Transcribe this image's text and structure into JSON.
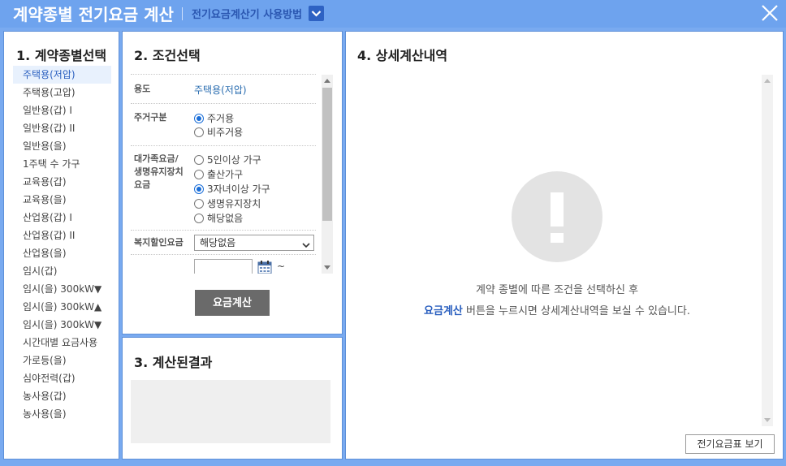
{
  "header": {
    "title": "계약종별 전기요금 계산",
    "help_link": "전기요금계산기 사용방법"
  },
  "panel1": {
    "title": "1. 계약종별선택",
    "items": [
      {
        "label": "주택용(저압)",
        "selected": true
      },
      {
        "label": "주택용(고압)"
      },
      {
        "label": "일반용(갑) I"
      },
      {
        "label": "일반용(갑) II"
      },
      {
        "label": "일반용(을)"
      },
      {
        "label": "1주택 수 가구"
      },
      {
        "label": "교육용(갑)"
      },
      {
        "label": "교육용(을)"
      },
      {
        "label": "산업용(갑) I"
      },
      {
        "label": "산업용(갑) II"
      },
      {
        "label": "산업용(을)"
      },
      {
        "label": "임시(갑)"
      },
      {
        "label": "임시(을) 300kW▼"
      },
      {
        "label": "임시(을) 300kW▲"
      },
      {
        "label": "임시(을) 300kW▼"
      },
      {
        "label": "시간대별 요금사용"
      },
      {
        "label": "가로등(을)"
      },
      {
        "label": "심야전력(갑)"
      },
      {
        "label": "농사용(갑)"
      },
      {
        "label": "농사용(을)"
      }
    ]
  },
  "panel2": {
    "title": "2. 조건선택",
    "usage_label": "용도",
    "usage_value": "주택용(저압)",
    "residence_label": "주거구분",
    "residence_options": [
      {
        "label": "주거용",
        "checked": true
      },
      {
        "label": "비주거용",
        "checked": false
      }
    ],
    "family_label_lines": [
      "대가족요금/",
      "생명유지장치",
      "요금"
    ],
    "family_options": [
      {
        "label": "5인이상 가구",
        "checked": false
      },
      {
        "label": "출산가구",
        "checked": false
      },
      {
        "label": "3자녀이상 가구",
        "checked": true
      },
      {
        "label": "생명유지장치",
        "checked": false
      },
      {
        "label": "해당없음",
        "checked": false
      }
    ],
    "welfare_label": "복지할인요금",
    "welfare_selected": "해당없음",
    "date_separator": "~",
    "calc_button": "요금계산"
  },
  "panel3": {
    "title": "3. 계산된결과"
  },
  "panel4": {
    "title": "4. 상세계산내역",
    "message_line1": "계약 종별에 따른 조건을 선택하신 후",
    "message_line2_highlight": "요금계산",
    "message_line2_rest": " 버튼을 누르시면 상세계산내역을 보실 수 있습니다.",
    "rate_table_button": "전기요금표 보기"
  },
  "colors": {
    "titlebar": "#6ea3ee",
    "accent_blue": "#2a5fbf",
    "calc_button_bg": "#6a6a6a"
  }
}
